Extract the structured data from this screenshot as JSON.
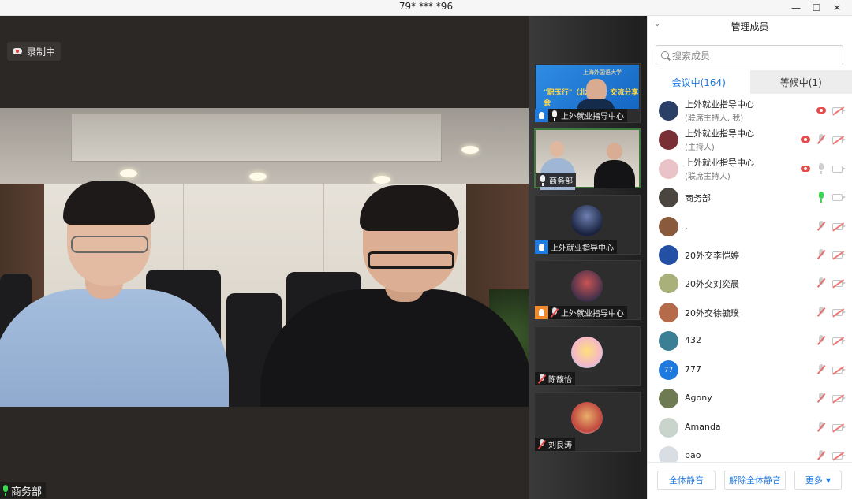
{
  "window": {
    "title": "79* *** *96"
  },
  "main": {
    "recording_label": "录制中",
    "speaker_name": "商务部"
  },
  "thumbnails": [
    {
      "label": "上外就业指导中心",
      "slide_text": "\"职玉行\"（北",
      "slide_text2": "交流分享会",
      "slide_logo": "上海外国语大学"
    },
    {
      "label": "商务部"
    },
    {
      "label": "上外就业指导中心"
    },
    {
      "label": "上外就业指导中心"
    },
    {
      "label": "陈馥怡"
    },
    {
      "label": "刘良涛"
    }
  ],
  "panel": {
    "title": "管理成员",
    "search_placeholder": "搜索成员",
    "tabs": [
      {
        "label": "会议中(164)"
      },
      {
        "label": "等候中(1)"
      }
    ],
    "members": [
      {
        "name": "上外就业指导中心",
        "role": "(联席主持人, 我)",
        "avatar_color": "#2a3f66"
      },
      {
        "name": "上外就业指导中心",
        "role": "(主持人)",
        "avatar_color": "#7a2f35"
      },
      {
        "name": "上外就业指导中心",
        "role": "(联席主持人)",
        "avatar_color": "#e9c3c7"
      },
      {
        "name": "商务部",
        "role": "",
        "avatar_color": "#4b4540"
      },
      {
        "name": ".",
        "role": "",
        "avatar_color": "#8a5a3c"
      },
      {
        "name": "20外交李恺婷",
        "role": "",
        "avatar_color": "#2350a4"
      },
      {
        "name": "20外交刘奕晨",
        "role": "",
        "avatar_color": "#a9b07a"
      },
      {
        "name": "20外交徐毓璞",
        "role": "",
        "avatar_color": "#b56a4a"
      },
      {
        "name": "432",
        "role": "",
        "avatar_color": "#3a7f93"
      },
      {
        "name": "777",
        "role": "",
        "avatar_text": "77",
        "avatar_color": "#1f7ae0"
      },
      {
        "name": "Agony",
        "role": "",
        "avatar_color": "#6d7a52"
      },
      {
        "name": "Amanda",
        "role": "",
        "avatar_color": "#c9d4cc"
      },
      {
        "name": "bao",
        "role": "",
        "avatar_color": "#d9dde4"
      }
    ],
    "buttons": {
      "mute_all": "全体静音",
      "unmute_all": "解除全体静音",
      "more": "更多"
    }
  },
  "colors": {
    "accent": "#1f7ae0",
    "recording_red": "#e74b4b",
    "speaking_green": "#3cd651"
  }
}
